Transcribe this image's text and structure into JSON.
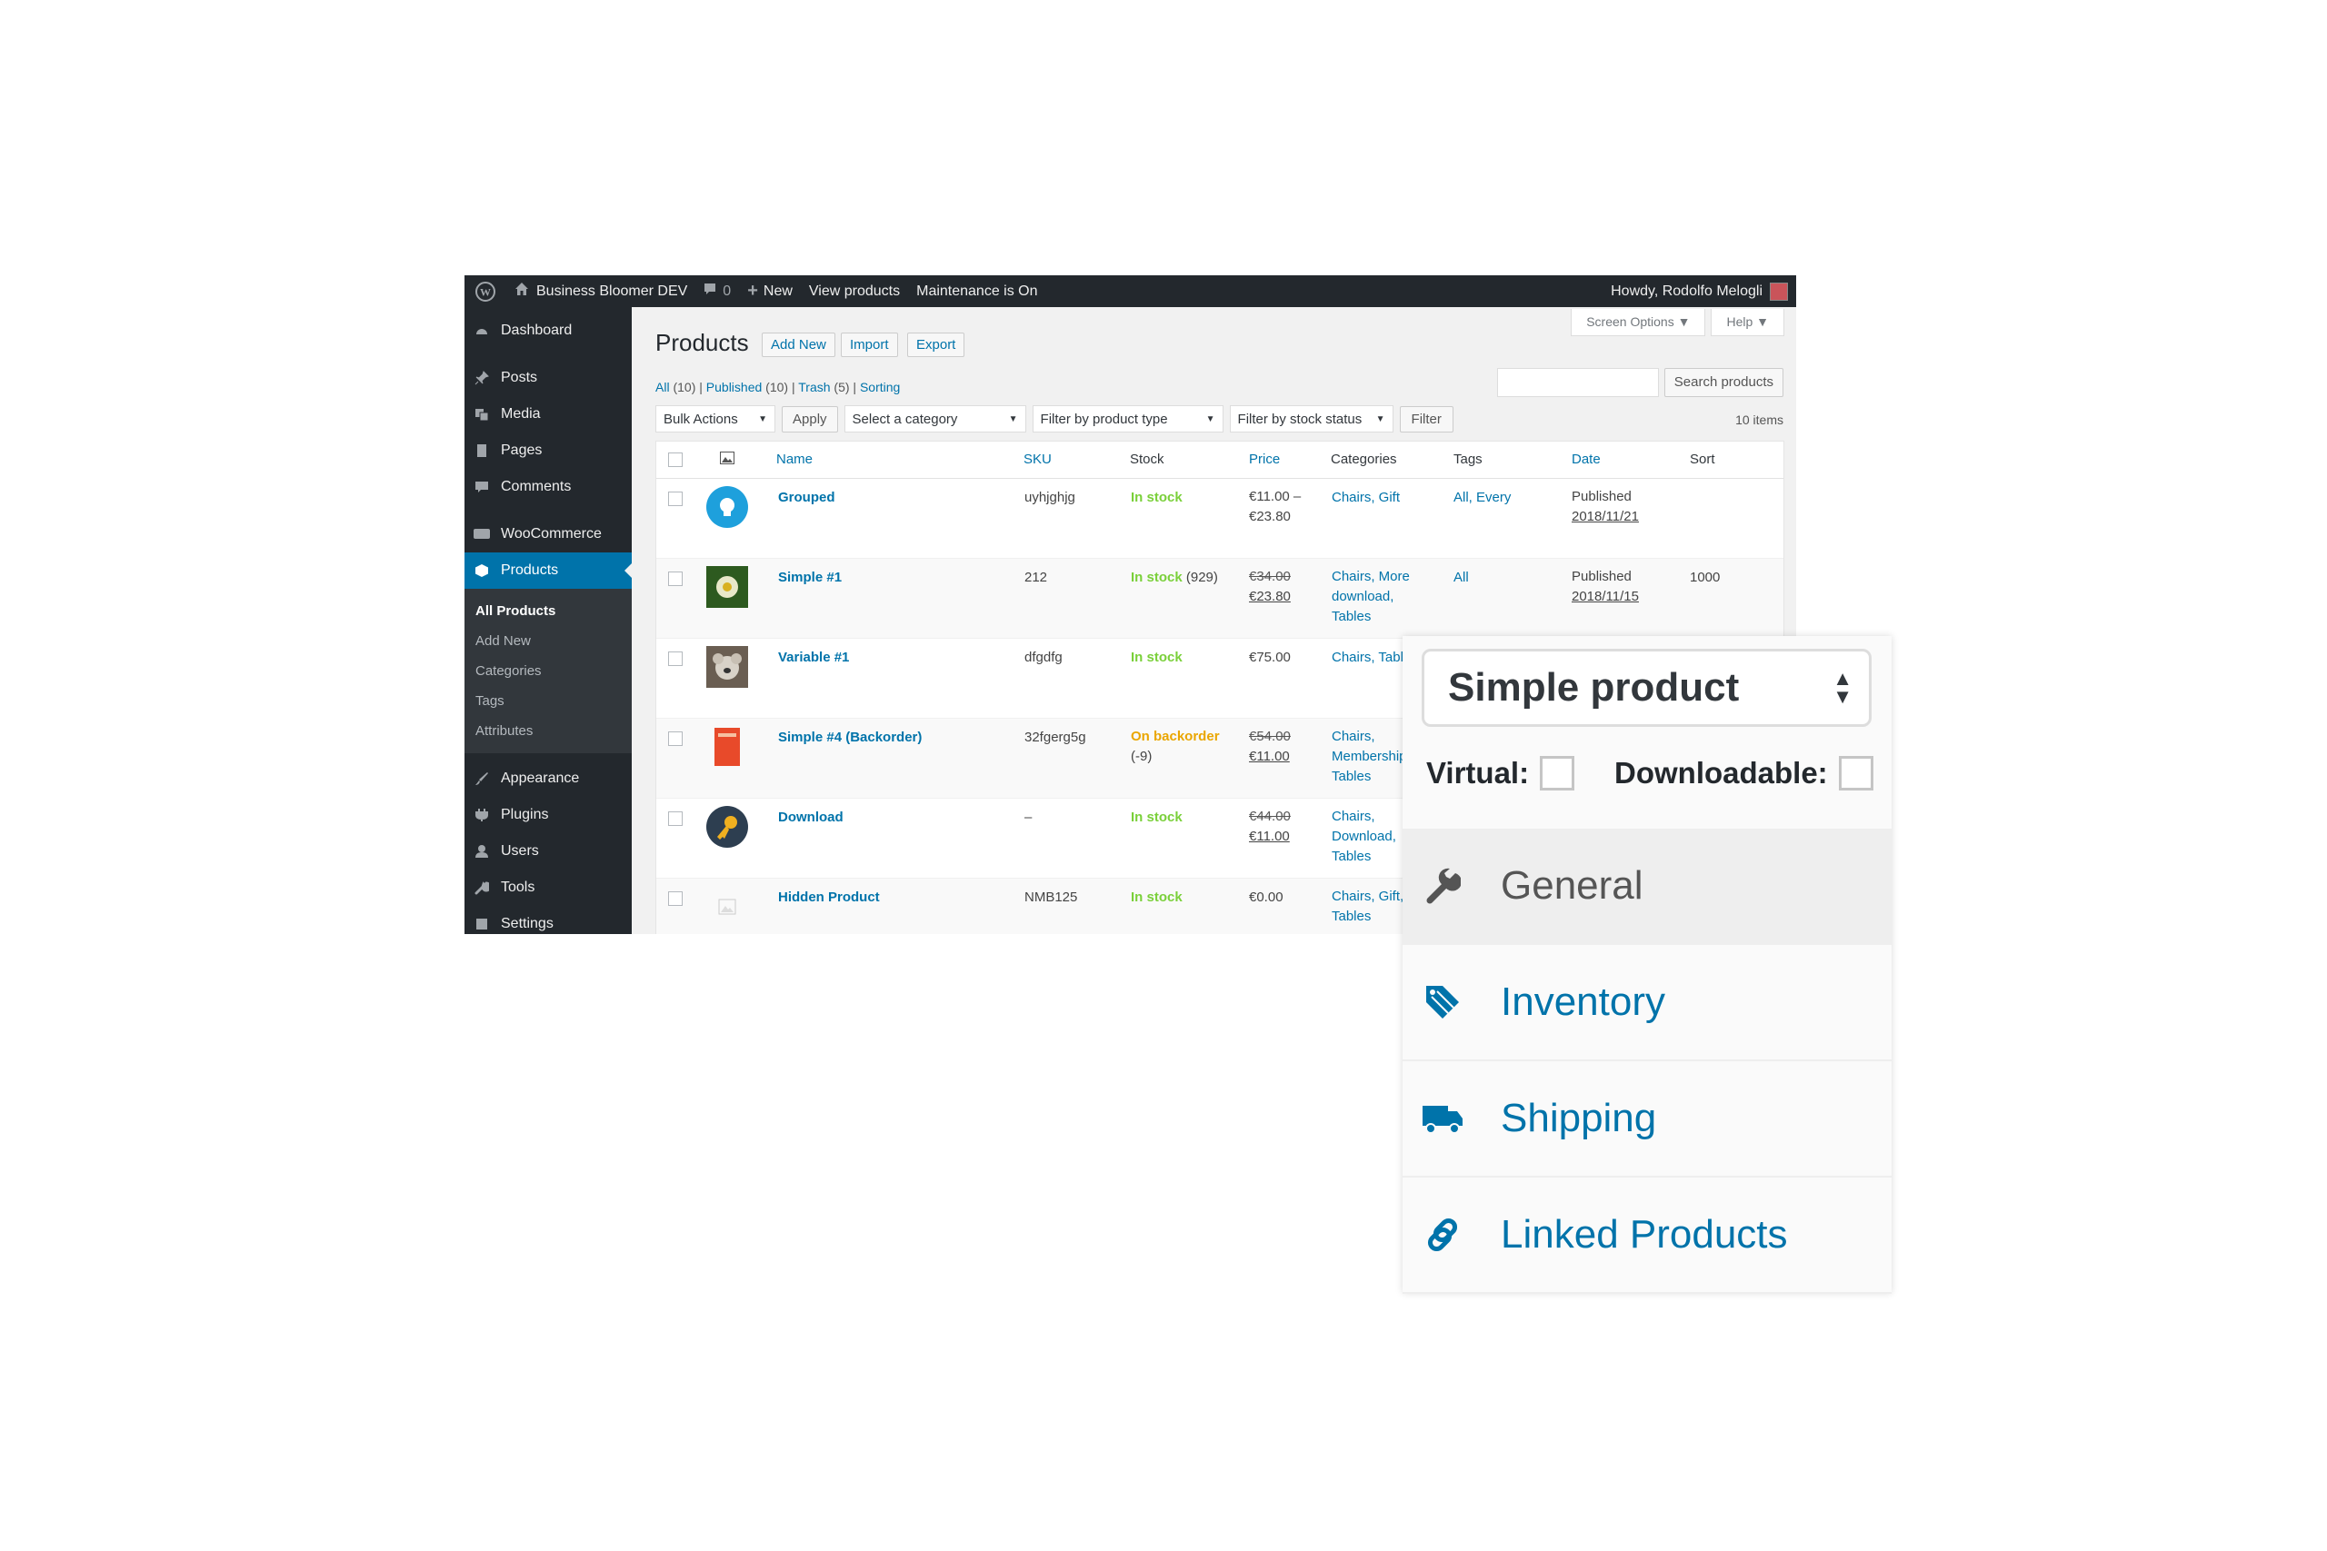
{
  "admin_bar": {
    "site_name": "Business Bloomer DEV",
    "comments_count": "0",
    "new_label": "New",
    "view_products": "View products",
    "maintenance": "Maintenance is On",
    "howdy": "Howdy, Rodolfo Melogli"
  },
  "sidebar": {
    "items": [
      {
        "label": "Dashboard",
        "icon": "dashboard-icon"
      },
      {
        "label": "Posts",
        "icon": "pin-icon"
      },
      {
        "label": "Media",
        "icon": "media-icon"
      },
      {
        "label": "Pages",
        "icon": "pages-icon"
      },
      {
        "label": "Comments",
        "icon": "comment-icon"
      },
      {
        "label": "WooCommerce",
        "icon": "woo-icon"
      },
      {
        "label": "Products",
        "icon": "cube-icon"
      },
      {
        "label": "Appearance",
        "icon": "brush-icon"
      },
      {
        "label": "Plugins",
        "icon": "plug-icon"
      },
      {
        "label": "Users",
        "icon": "user-icon"
      },
      {
        "label": "Tools",
        "icon": "wrench-icon"
      },
      {
        "label": "Settings",
        "icon": "settings-icon"
      }
    ],
    "submenu": [
      "All Products",
      "Add New",
      "Categories",
      "Tags",
      "Attributes"
    ]
  },
  "main": {
    "screen_options": "Screen Options ▼",
    "help": "Help ▼",
    "title": "Products",
    "actions": [
      "Add New",
      "Import",
      "Export"
    ],
    "views": {
      "all": "All",
      "all_count": "(10)",
      "published": "Published",
      "published_count": "(10)",
      "trash": "Trash",
      "trash_count": "(5)",
      "sorting": "Sorting"
    },
    "search_button": "Search products",
    "bulk_actions": "Bulk Actions",
    "apply": "Apply",
    "category_filter": "Select a category",
    "type_filter": "Filter by product type",
    "stock_filter": "Filter by stock status",
    "filter_button": "Filter",
    "items_count": "10 items"
  },
  "table": {
    "columns": [
      "Name",
      "SKU",
      "Stock",
      "Price",
      "Categories",
      "Tags",
      "Date",
      "Sort"
    ],
    "rows": [
      {
        "name": "Grouped",
        "sku": "uyhjghjg",
        "stock": "In stock",
        "stock_extra": "",
        "price1": "€11.00 –",
        "price2": "€23.80",
        "cat1": "Chairs, Gift",
        "cat2": "",
        "cat3": "",
        "tags": "All, Every",
        "date_status": "Published",
        "date": "2018/11/21",
        "sort": ""
      },
      {
        "name": "Simple #1",
        "sku": "212",
        "stock": "In stock",
        "stock_extra": "(929)",
        "price1": "€34.00",
        "price2": "€23.80",
        "cat1": "Chairs, More",
        "cat2": "download,",
        "cat3": "Tables",
        "tags": "All",
        "date_status": "Published",
        "date": "2018/11/15",
        "sort": "1000"
      },
      {
        "name": "Variable #1",
        "sku": "dfgdfg",
        "stock": "In stock",
        "stock_extra": "",
        "price1": "€75.00",
        "price2": "",
        "cat1": "Chairs, Tabl",
        "cat2": "",
        "cat3": "",
        "tags": "",
        "date_status": "",
        "date": "",
        "sort": ""
      },
      {
        "name": "Simple #4 (Backorder)",
        "sku": "32fgerg5g",
        "stock": "On backorder",
        "stock_extra": "(-9)",
        "price1": "€54.00",
        "price2": "€11.00",
        "cat1": "Chairs,",
        "cat2": "Membership",
        "cat3": "Tables",
        "tags": "",
        "date_status": "",
        "date": "",
        "sort": ""
      },
      {
        "name": "Download",
        "sku": "–",
        "stock": "In stock",
        "stock_extra": "",
        "price1": "€44.00",
        "price2": "€11.00",
        "cat1": "Chairs,",
        "cat2": "Download,",
        "cat3": "Tables",
        "tags": "",
        "date_status": "",
        "date": "",
        "sort": ""
      },
      {
        "name": "Hidden Product",
        "sku": "NMB125",
        "stock": "In stock",
        "stock_extra": "",
        "price1": "€0.00",
        "price2": "",
        "cat1": "Chairs, Gift,",
        "cat2": "Tables",
        "cat3": "",
        "tags": "",
        "date_status": "",
        "date": "",
        "sort": ""
      }
    ]
  },
  "panel": {
    "product_type": "Simple product",
    "virtual_label": "Virtual:",
    "downloadable_label": "Downloadable:",
    "tabs": [
      {
        "label": "General",
        "icon": "wrench-icon"
      },
      {
        "label": "Inventory",
        "icon": "tag-icon"
      },
      {
        "label": "Shipping",
        "icon": "truck-icon"
      },
      {
        "label": "Linked Products",
        "icon": "link-icon"
      }
    ]
  },
  "colors": {
    "admin_dark": "#23282d",
    "accent_blue": "#0073aa",
    "in_stock_green": "#7ad03a",
    "backorder_orange": "#eaa600"
  }
}
